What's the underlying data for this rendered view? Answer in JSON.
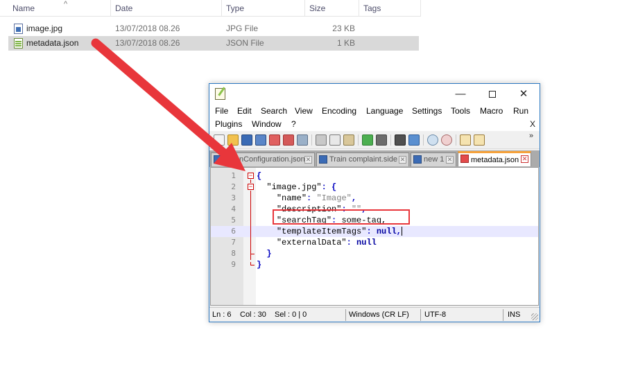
{
  "explorer": {
    "columns": [
      "Name",
      "Date",
      "Type",
      "Size",
      "Tags"
    ],
    "sort_indicator": "^",
    "files": [
      {
        "name": "image.jpg",
        "date": "13/07/2018 08.26",
        "type": "JPG File",
        "size": "23 KB",
        "icon": "image-file-icon"
      },
      {
        "name": "metadata.json",
        "date": "13/07/2018 08.26",
        "type": "JSON File",
        "size": "1 KB",
        "icon": "json-file-icon",
        "selected": true
      }
    ]
  },
  "notepad": {
    "window_controls": {
      "minimize": "—",
      "close": "✕"
    },
    "menu_row1": [
      "File",
      "Edit",
      "Search",
      "View",
      "Encoding",
      "Language",
      "Settings",
      "Tools",
      "Macro",
      "Run"
    ],
    "menu_row2": [
      "Plugins",
      "Window",
      "?"
    ],
    "doc_close": "X",
    "toolbar_more": "»",
    "tabs": [
      {
        "label": "nConfiguration.json",
        "active": false
      },
      {
        "label": "Train complaint.side",
        "active": false
      },
      {
        "label": "new 1",
        "active": false
      },
      {
        "label": "metadata.json",
        "active": true
      }
    ],
    "code_lines": [
      {
        "num": "1"
      },
      {
        "num": "2"
      },
      {
        "num": "3"
      },
      {
        "num": "4"
      },
      {
        "num": "5"
      },
      {
        "num": "6"
      },
      {
        "num": "7"
      },
      {
        "num": "8"
      },
      {
        "num": "9"
      }
    ],
    "tokens": {
      "open_brace": "{",
      "close_brace": "}",
      "key_image": "\"image.jpg\"",
      "key_name": "\"name\"",
      "val_name": "\"Image\"",
      "key_description": "\"description\"",
      "val_description": "\"\"",
      "key_searchtag": "\"searchTag\"",
      "val_searchtag": "some-tag,",
      "key_templateitemtags": "\"templateItemTags\"",
      "key_externaldata": "\"externalData\"",
      "colon": ":",
      "comma": ",",
      "null": "null"
    },
    "status": {
      "ln": "Ln : 6",
      "col": "Col : 30",
      "sel": "Sel : 0 | 0",
      "eol": "Windows (CR LF)",
      "encoding": "UTF-8",
      "mode": "INS"
    }
  },
  "colors": {
    "annotation_red": "#e8363b",
    "active_tab_accent": "#f7a23b",
    "current_line": "#e8e8ff"
  }
}
